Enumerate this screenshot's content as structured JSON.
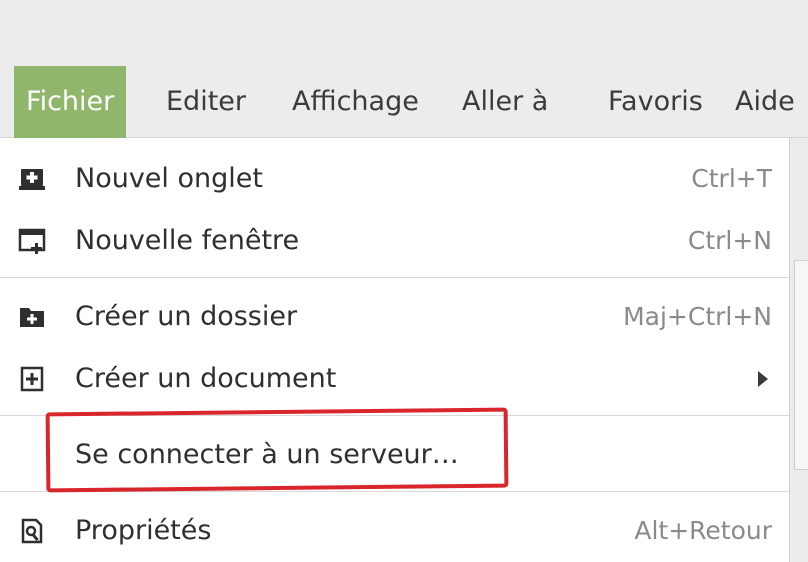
{
  "menubar": {
    "items": [
      {
        "label": "Fichier",
        "active": true
      },
      {
        "label": "Editer",
        "active": false
      },
      {
        "label": "Affichage",
        "active": false
      },
      {
        "label": "Aller à",
        "active": false
      },
      {
        "label": "Favoris",
        "active": false
      },
      {
        "label": "Aide",
        "active": false
      }
    ]
  },
  "menu": {
    "items": [
      {
        "label": "Nouvel onglet",
        "shortcut": "Ctrl+T",
        "icon": "new-tab-icon"
      },
      {
        "label": "Nouvelle fenêtre",
        "shortcut": "Ctrl+N",
        "icon": "new-window-icon"
      },
      {
        "label": "Créer un dossier",
        "shortcut": "Maj+Ctrl+N",
        "icon": "create-folder-icon"
      },
      {
        "label": "Créer un document",
        "shortcut": "",
        "icon": "create-document-icon",
        "has_submenu": true
      },
      {
        "label": "Se connecter à un serveur…",
        "shortcut": "",
        "icon": "",
        "annotated": true
      },
      {
        "label": "Propriétés",
        "shortcut": "Alt+Retour",
        "icon": "properties-icon"
      }
    ]
  },
  "colors": {
    "active_menu_bg": "#8fb66b",
    "annotation": "#d8262c",
    "menubar_bg": "#ececec"
  }
}
